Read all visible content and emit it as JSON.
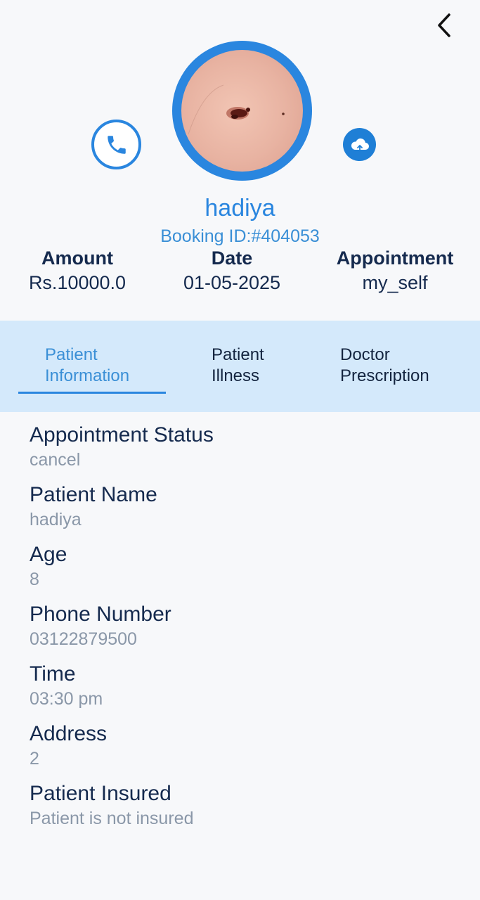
{
  "header": {
    "back_icon": "chevron-left-icon",
    "call_icon": "phone-icon",
    "upload_icon": "cloud-upload-icon"
  },
  "profile": {
    "name": "hadiya",
    "booking_id": "Booking ID:#404053"
  },
  "stats": [
    {
      "label": "Amount",
      "value": "Rs.10000.0"
    },
    {
      "label": "Date",
      "value": "01-05-2025"
    },
    {
      "label": "Appointment",
      "value": "my_self"
    }
  ],
  "tabs": [
    {
      "line1": "Patient",
      "line2": "Information",
      "active": true
    },
    {
      "line1": "Patient",
      "line2": "Illness",
      "active": false
    },
    {
      "line1": "Doctor",
      "line2": "Prescription",
      "active": false
    }
  ],
  "fields": [
    {
      "label": "Appointment Status",
      "value": "cancel"
    },
    {
      "label": "Patient Name",
      "value": "hadiya"
    },
    {
      "label": "Age",
      "value": "8"
    },
    {
      "label": "Phone Number",
      "value": "03122879500"
    },
    {
      "label": "Time",
      "value": "03:30 pm"
    },
    {
      "label": "Address",
      "value": "2"
    },
    {
      "label": "Patient Insured",
      "value": "Patient is not insured"
    }
  ],
  "colors": {
    "accent": "#2a86df",
    "tab_bar": "#d4e9fb",
    "text_dark": "#152a4e",
    "text_muted": "#8a97a8"
  }
}
